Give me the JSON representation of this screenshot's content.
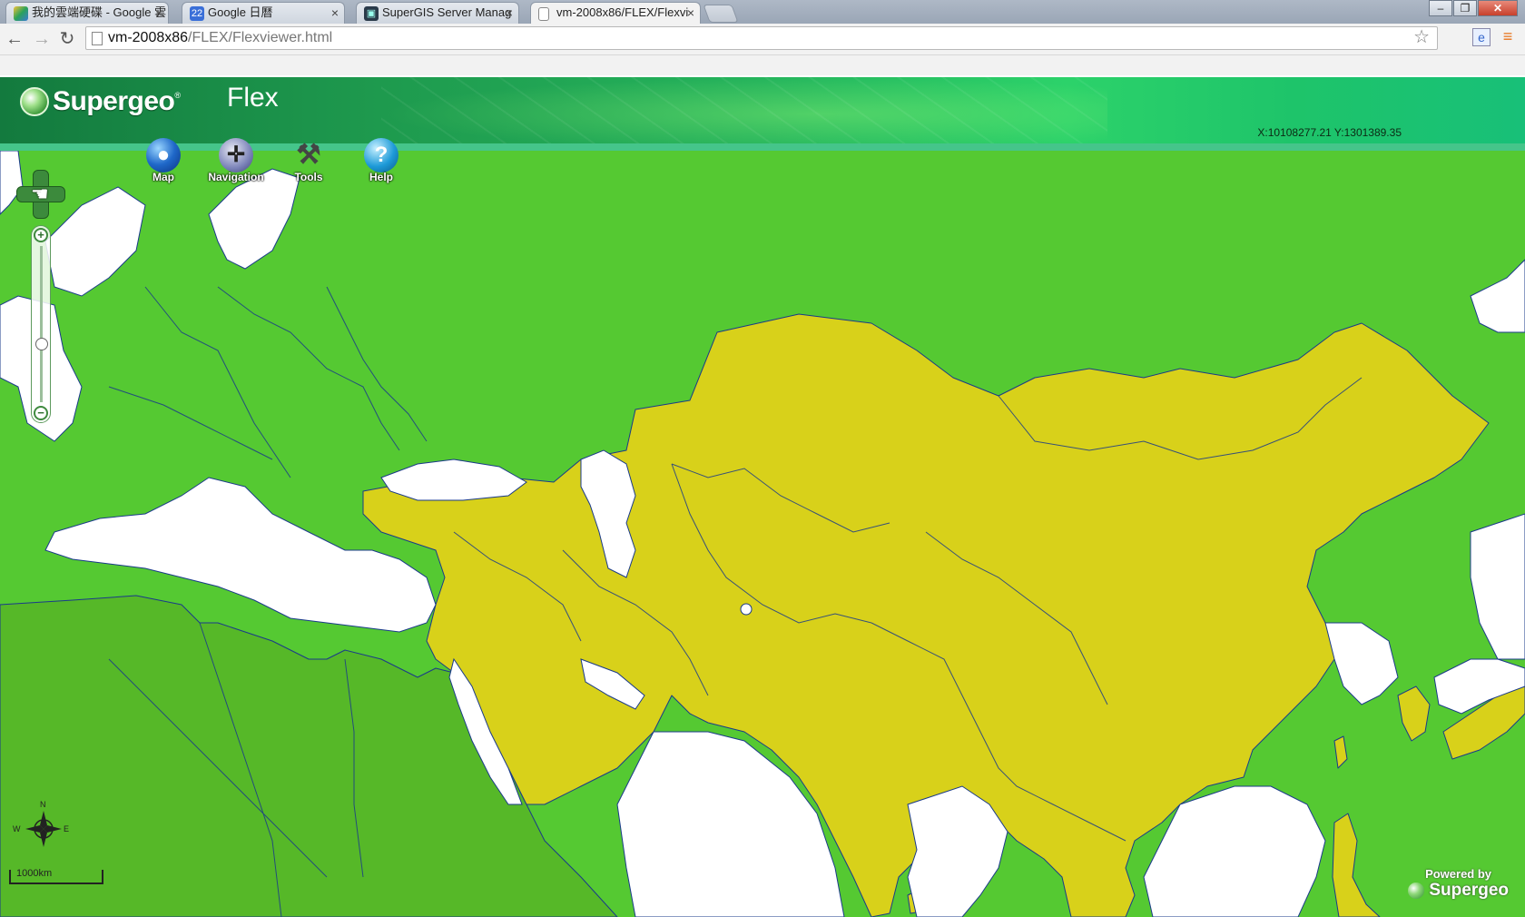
{
  "browser": {
    "tabs": [
      {
        "title": "我的雲端硬碟 - Google 雲",
        "icon": "google-drive-icon"
      },
      {
        "title": "Google 日曆",
        "icon": "google-calendar-icon",
        "icon_text": "22"
      },
      {
        "title": "SuperGIS Server Manag",
        "icon": "server-manager-icon"
      },
      {
        "title": "vm-2008x86/FLEX/Flexvi",
        "icon": "page-icon"
      }
    ],
    "active_tab": 3,
    "window_buttons": {
      "minimize": "–",
      "restore": "❐",
      "close": "✕"
    },
    "url_host": "vm-2008x86",
    "url_path": "/FLEX/Flexviewer.html"
  },
  "app": {
    "logo_text": "Supergeo",
    "title": "Flex",
    "coordinates": "X:10108277.21 Y:1301389.35",
    "menu": [
      {
        "label": "Map",
        "icon": "globe-icon"
      },
      {
        "label": "Navigation",
        "icon": "compass-navigation-icon"
      },
      {
        "label": "Tools",
        "icon": "tools-icon"
      },
      {
        "label": "Help",
        "icon": "help-icon"
      }
    ],
    "scale_label": "1000km",
    "compass_labels": {
      "n": "N",
      "w": "W",
      "e": "E"
    },
    "powered_by": "Powered by",
    "powered_brand": "Supergeo",
    "zoom_level_fraction": 0.62
  },
  "colors": {
    "header_dark": "#137a3e",
    "header_light": "#1ec46a",
    "map_green": "#55c932",
    "africa_green": "#56b828",
    "asia_yellow": "#d8d11a",
    "water": "#ffffff",
    "border": "#1a3a8a"
  }
}
